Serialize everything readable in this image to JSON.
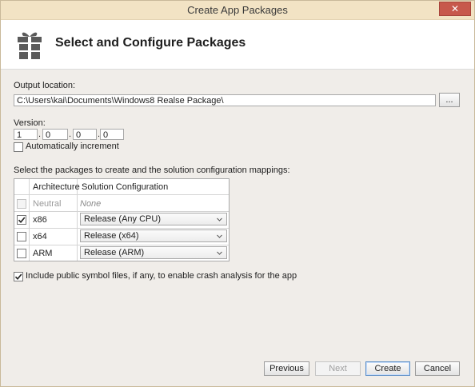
{
  "window": {
    "title": "Create App Packages",
    "close_glyph": "✕"
  },
  "header": {
    "title": "Select and Configure Packages",
    "icon": "gift-icon"
  },
  "output": {
    "label": "Output location:",
    "value": "C:\\Users\\kai\\Documents\\Windows8 Realse Package\\",
    "browse_label": "..."
  },
  "version": {
    "label": "Version:",
    "parts": [
      "1",
      "0",
      "0",
      "0"
    ],
    "separator": ".",
    "auto_increment_label": "Automatically increment",
    "auto_increment_checked": false
  },
  "packages": {
    "prompt": "Select the packages to create and the solution configuration mappings:",
    "columns": [
      "Architecture",
      "Solution Configuration"
    ],
    "rows": [
      {
        "architecture": "Neutral",
        "configuration": "None",
        "checked": false,
        "enabled": false
      },
      {
        "architecture": "x86",
        "configuration": "Release (Any CPU)",
        "checked": true,
        "enabled": true
      },
      {
        "architecture": "x64",
        "configuration": "Release (x64)",
        "checked": false,
        "enabled": true
      },
      {
        "architecture": "ARM",
        "configuration": "Release (ARM)",
        "checked": false,
        "enabled": true
      }
    ]
  },
  "symbols": {
    "label": "Include public symbol files, if any, to enable crash analysis for the app",
    "checked": true
  },
  "footer": {
    "previous_label": "Previous",
    "next_label": "Next",
    "create_label": "Create",
    "cancel_label": "Cancel"
  },
  "colors": {
    "titlebar": "#f2e3c4",
    "close_button": "#c7584c",
    "dialog_background": "#f0ede9",
    "default_button_border": "#5b8ec7"
  }
}
